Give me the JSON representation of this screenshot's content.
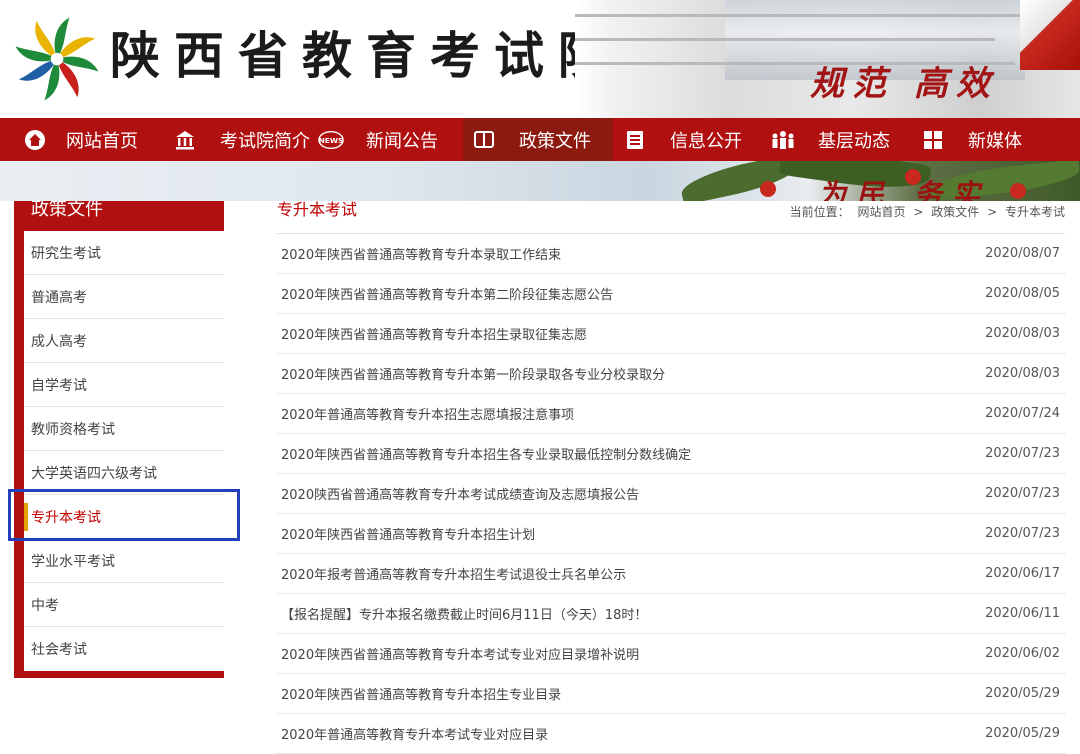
{
  "header": {
    "site_title": "陕西省教育考试院",
    "slogan": "规范 高效",
    "logo_icon": "pinwheel-logo-icon",
    "colors": {
      "logo_green": "#1e8a3a",
      "logo_yellow": "#e8b400",
      "logo_red": "#c8201a",
      "logo_blue": "#1f5fa6"
    }
  },
  "nav": {
    "items": [
      {
        "label": "网站首页",
        "icon": "home-icon"
      },
      {
        "label": "考试院简介",
        "icon": "building-icon"
      },
      {
        "label": "新闻公告",
        "icon": "news-icon"
      },
      {
        "label": "政策文件",
        "icon": "book-icon",
        "active": true
      },
      {
        "label": "信息公开",
        "icon": "document-icon"
      },
      {
        "label": "基层动态",
        "icon": "people-icon"
      },
      {
        "label": "新媒体",
        "icon": "grid-icon"
      }
    ],
    "news_icon_text": "NEWS",
    "colors": {
      "bar": "#b01010",
      "active": "#8d1a10"
    }
  },
  "banner": {
    "slogan": "为民 务实"
  },
  "sidebar": {
    "title": "政策文件",
    "items": [
      {
        "label": "研究生考试"
      },
      {
        "label": "普通高考"
      },
      {
        "label": "成人高考"
      },
      {
        "label": "自学考试"
      },
      {
        "label": "教师资格考试"
      },
      {
        "label": "大学英语四六级考试"
      },
      {
        "label": "专升本考试",
        "active": true
      },
      {
        "label": "学业水平考试"
      },
      {
        "label": "中考"
      },
      {
        "label": "社会考试"
      }
    ],
    "colors": {
      "frame": "#b01010",
      "active_text": "#c00000",
      "active_marker": "#e6a200",
      "highlight_box": "#2340b8"
    }
  },
  "content": {
    "section_title": "专升本考试",
    "breadcrumb": {
      "prefix": "当前位置：",
      "items": [
        "网站首页",
        "政策文件",
        "专升本考试"
      ],
      "separator": ">"
    },
    "articles": [
      {
        "title": "2020年陕西省普通高等教育专升本录取工作结束",
        "date": "2020/08/07"
      },
      {
        "title": "2020年陕西省普通高等教育专升本第二阶段征集志愿公告",
        "date": "2020/08/05"
      },
      {
        "title": "2020年陕西省普通高等教育专升本招生录取征集志愿",
        "date": "2020/08/03"
      },
      {
        "title": "2020年陕西省普通高等教育专升本第一阶段录取各专业分校录取分",
        "date": "2020/08/03"
      },
      {
        "title": "2020年普通高等教育专升本招生志愿填报注意事项",
        "date": "2020/07/24"
      },
      {
        "title": "2020年陕西省普通高等教育专升本招生各专业录取最低控制分数线确定",
        "date": "2020/07/23"
      },
      {
        "title": "2020陕西省普通高等教育专升本考试成绩查询及志愿填报公告",
        "date": "2020/07/23"
      },
      {
        "title": "2020年陕西省普通高等教育专升本招生计划",
        "date": "2020/07/23"
      },
      {
        "title": "2020年报考普通高等教育专升本招生考试退役士兵名单公示",
        "date": "2020/06/17"
      },
      {
        "title": "【报名提醒】专升本报名缴费截止时间6月11日（今天）18时！",
        "date": "2020/06/11"
      },
      {
        "title": "2020年陕西省普通高等教育专升本考试专业对应目录增补说明",
        "date": "2020/06/02"
      },
      {
        "title": "2020年陕西省普通高等教育专升本招生专业目录",
        "date": "2020/05/29"
      },
      {
        "title": "2020年普通高等教育专升本考试专业对应目录",
        "date": "2020/05/29"
      }
    ]
  }
}
